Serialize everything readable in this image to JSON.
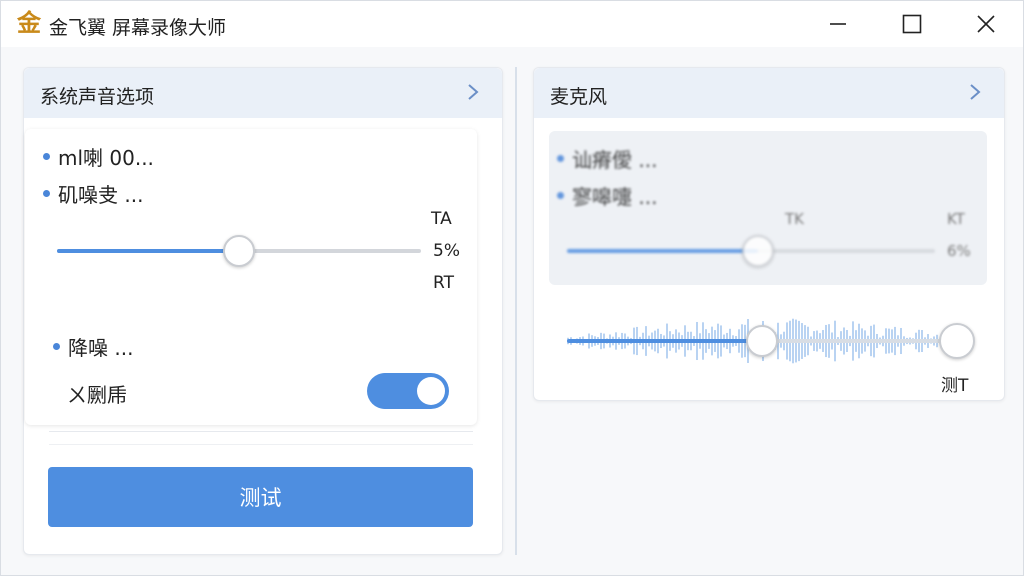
{
  "window": {
    "title": "金飞翼 屏幕录像大师",
    "logo_glyph": "金",
    "controls": {
      "minimize": "minimize-icon",
      "maximize": "maximize-icon",
      "close": "close-icon"
    }
  },
  "system_panel": {
    "header": "系统声音选项",
    "items": [
      "ml喇 00...",
      "矶噪叏 ..."
    ],
    "slider": {
      "value": 0.5,
      "label_top": "TA",
      "label_mid": "5%",
      "label_bottom": "RT"
    },
    "noise_item": "降噪 ...",
    "toggle_label": "ㄨ劂乕",
    "toggle_on": true,
    "button": "测试"
  },
  "mic_panel": {
    "header": "麦克风",
    "items": [
      "讪瘠僾 ...",
      "寥嗥嚏 ..."
    ],
    "slider": {
      "value": 0.52,
      "label_left": "TK",
      "label_right": "KT",
      "label_right_value": "6%"
    },
    "wave_slider": {
      "value": 0.5
    },
    "wave_label": "测T"
  },
  "colors": {
    "accent": "#4e8ee0",
    "header_bg": "#eaf0f8",
    "logo": "#c98a1a"
  }
}
